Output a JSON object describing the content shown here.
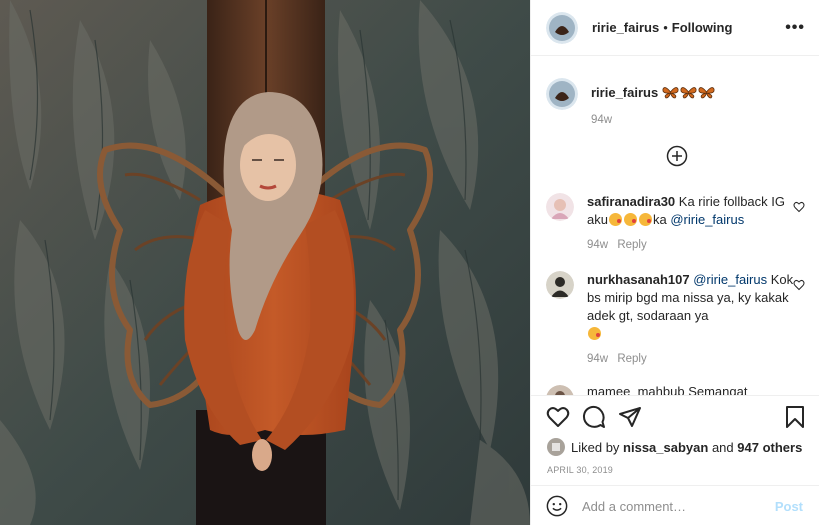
{
  "post": {
    "author": "ririe_fairus",
    "follow_status": "Following",
    "more_label": "•••",
    "caption_emoji": [
      "butterfly",
      "butterfly",
      "butterfly"
    ],
    "caption_time": "94w"
  },
  "comments": [
    {
      "username": "safiranadira30",
      "text_before": "Ka ririe follback IG aku",
      "emoji_count": 3,
      "text_after": "ka",
      "mention": "@ririe_fairus",
      "time": "94w",
      "reply_label": "Reply"
    },
    {
      "username": "nurkhasanah107",
      "mention": "@ririe_fairus",
      "text": "Kok bs mirip bgd ma nissa ya, ky kakak adek gt, sodaraan ya",
      "emoji_count": 1,
      "time": "94w",
      "reply_label": "Reply"
    }
  ],
  "partial_comment": {
    "username": "mamee_mahbub",
    "text": "Semangat"
  },
  "likes": {
    "prefix": "Liked by",
    "user": "nissa_sabyan",
    "and": "and",
    "others": "947 others"
  },
  "date": "APRIL 30, 2019",
  "comment_box": {
    "placeholder": "Add a comment…",
    "post_label": "Post"
  },
  "icons": {
    "more": "more-options-icon",
    "load_more": "plus-circle-icon",
    "like": "heart-icon",
    "comment": "comment-icon",
    "share": "paper-plane-icon",
    "save": "bookmark-icon",
    "emoji": "smiley-icon"
  }
}
